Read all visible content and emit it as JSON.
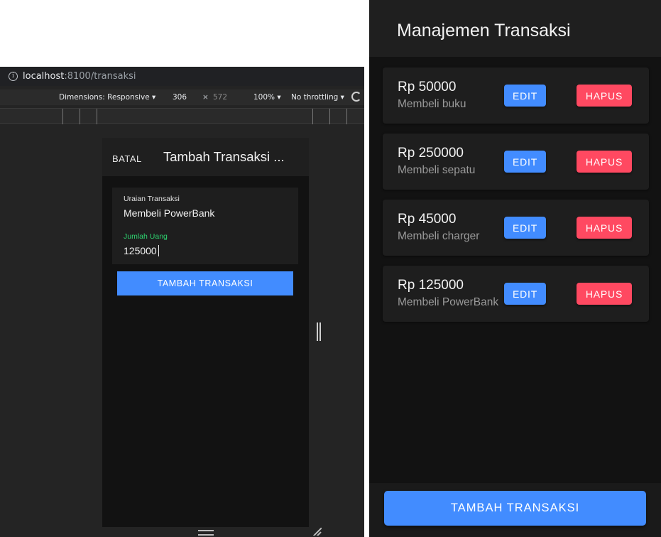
{
  "left": {
    "url": {
      "host": "localhost",
      "path": ":8100/transaksi"
    },
    "devtools": {
      "dimensions_label": "Dimensions: Responsive ▾",
      "width": "306",
      "times": "×",
      "height": "572",
      "zoom": "100% ▾",
      "throttling": "No throttling ▾"
    },
    "device": {
      "cancel_label": "BATAL",
      "title": "Tambah Transaksi ...",
      "form": {
        "desc_label": "Uraian Transaksi",
        "desc_value": "Membeli PowerBank",
        "amount_label": "Jumlah Uang",
        "amount_value": "125000"
      },
      "submit_label": "TAMBAH TRANSAKSI"
    }
  },
  "right": {
    "title": "Manajemen Transaksi",
    "transactions": [
      {
        "amount": "Rp 50000",
        "desc": "Membeli buku"
      },
      {
        "amount": "Rp 250000",
        "desc": "Membeli sepatu"
      },
      {
        "amount": "Rp 45000",
        "desc": "Membeli charger"
      },
      {
        "amount": "Rp 125000",
        "desc": "Membeli PowerBank"
      }
    ],
    "edit_label": "EDIT",
    "delete_label": "HAPUS",
    "add_label": "TAMBAH TRANSAKSI"
  },
  "colors": {
    "primary": "#428cff",
    "danger": "#ff4961",
    "success": "#2dd36f",
    "background": "#121212"
  }
}
